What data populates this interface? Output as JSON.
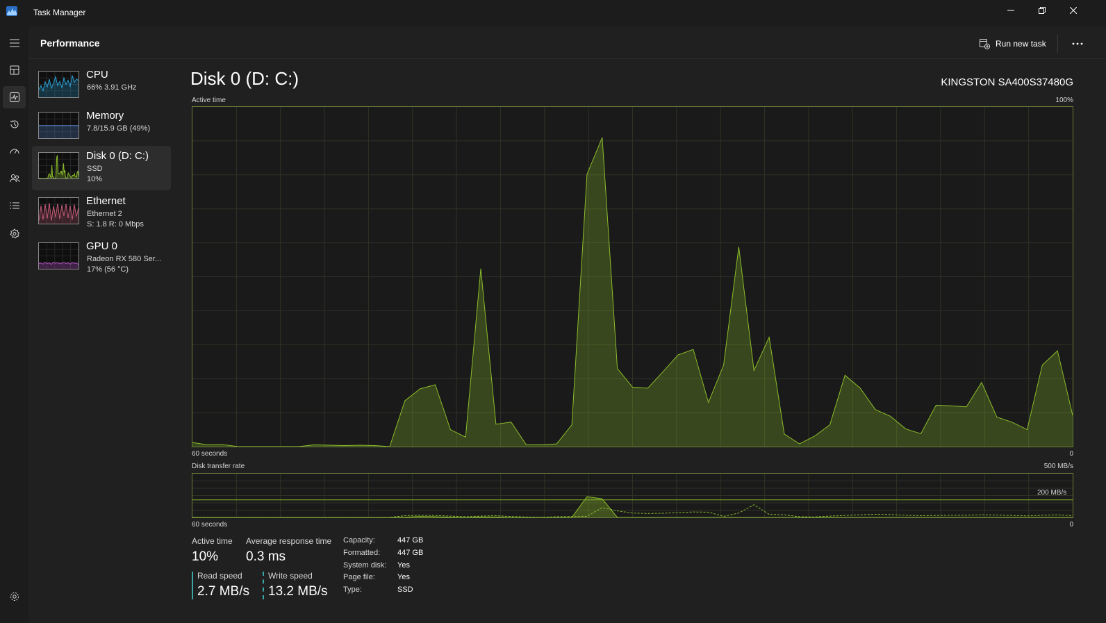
{
  "app": {
    "title": "Task Manager"
  },
  "colors": {
    "disk_accent": "#8cbd2a",
    "cpu": "#2a9fd6",
    "memory": "#5b8ad8",
    "ethernet": "#c45a78",
    "gpu": "#b04fc4"
  },
  "header": {
    "title": "Performance",
    "run_new_task": "Run new task"
  },
  "rail": [
    "menu-icon",
    "processes-icon",
    "performance-icon",
    "app-history-icon",
    "startup-apps-icon",
    "users-icon",
    "details-icon",
    "services-icon",
    "settings-icon"
  ],
  "resources": [
    {
      "name": "CPU",
      "line1": "66% 3.91 GHz",
      "line2": ""
    },
    {
      "name": "Memory",
      "line1": "7.8/15.9 GB (49%)",
      "line2": ""
    },
    {
      "name": "Disk 0 (D: C:)",
      "line1": "SSD",
      "line2": "10%"
    },
    {
      "name": "Ethernet",
      "line1": "Ethernet 2",
      "line2": "S: 1.8  R: 0 Mbps"
    },
    {
      "name": "GPU 0",
      "line1": "Radeon RX 580 Ser...",
      "line2": "17%  (56 °C)"
    }
  ],
  "disk": {
    "title": "Disk 0 (D: C:)",
    "model": "KINGSTON SA400S37480G",
    "active_time_graph": {
      "label": "Active time",
      "max_label": "100%",
      "x_left": "60 seconds",
      "x_right": "0",
      "values": [
        1.2,
        0.5,
        0.6,
        0,
        0,
        0,
        0,
        0,
        0.5,
        0.4,
        0.3,
        0.4,
        0.3,
        0,
        13.5,
        17,
        18.2,
        5,
        2.8,
        52.4,
        6.6,
        7.2,
        0.5,
        0.5,
        0.8,
        6.4,
        80.2,
        91,
        23,
        17.5,
        17.2,
        22,
        27,
        28.6,
        13,
        24,
        58.8,
        22.4,
        32.2,
        3.7,
        0.8,
        3.1,
        6.4,
        21,
        17.2,
        10.9,
        8.9,
        5.2,
        3.8,
        12.2,
        12,
        11.7,
        18.9,
        8.7,
        7.2,
        5,
        24,
        28.2,
        9.2
      ]
    },
    "transfer_graph": {
      "label": "Disk transfer rate",
      "max_label": "500 MB/s",
      "ref_label": "200 MB/s",
      "x_left": "60 seconds",
      "x_right": "0",
      "read_values": [
        0,
        0,
        0,
        0,
        0,
        0,
        0,
        0,
        0,
        0,
        0,
        0,
        0,
        0,
        1,
        4,
        3,
        1,
        0,
        2,
        2,
        0,
        0,
        0,
        0,
        0,
        95,
        85,
        0,
        0,
        0,
        0,
        0,
        0,
        0,
        0,
        0,
        0,
        0,
        0,
        0,
        0,
        0,
        0,
        0,
        0,
        0,
        0,
        0,
        0,
        0,
        0,
        0,
        0,
        0,
        0,
        0,
        0,
        0
      ],
      "write_values": [
        1,
        0.5,
        0.6,
        0.3,
        0.2,
        0.2,
        0.2,
        0.2,
        0.5,
        0.4,
        0.3,
        0.4,
        0.3,
        0.3,
        8,
        10,
        9,
        6,
        3,
        6,
        8,
        4,
        2,
        1,
        3,
        4,
        5,
        45,
        30,
        20,
        18,
        19,
        22,
        25,
        24,
        5,
        20,
        58,
        14,
        12,
        3,
        2,
        6,
        9,
        12,
        14,
        13,
        10,
        8,
        9,
        10,
        10,
        12,
        11,
        9,
        7,
        10,
        12,
        8
      ]
    },
    "stats": {
      "active_time": {
        "label": "Active time",
        "value": "10%"
      },
      "avg_response": {
        "label": "Average response time",
        "value": "0.3 ms"
      },
      "read_speed": {
        "label": "Read speed",
        "value": "2.7 MB/s"
      },
      "write_speed": {
        "label": "Write speed",
        "value": "13.2 MB/s"
      }
    },
    "info": [
      {
        "key": "Capacity:",
        "value": "447 GB"
      },
      {
        "key": "Formatted:",
        "value": "447 GB"
      },
      {
        "key": "System disk:",
        "value": "Yes"
      },
      {
        "key": "Page file:",
        "value": "Yes"
      },
      {
        "key": "Type:",
        "value": "SSD"
      }
    ]
  }
}
